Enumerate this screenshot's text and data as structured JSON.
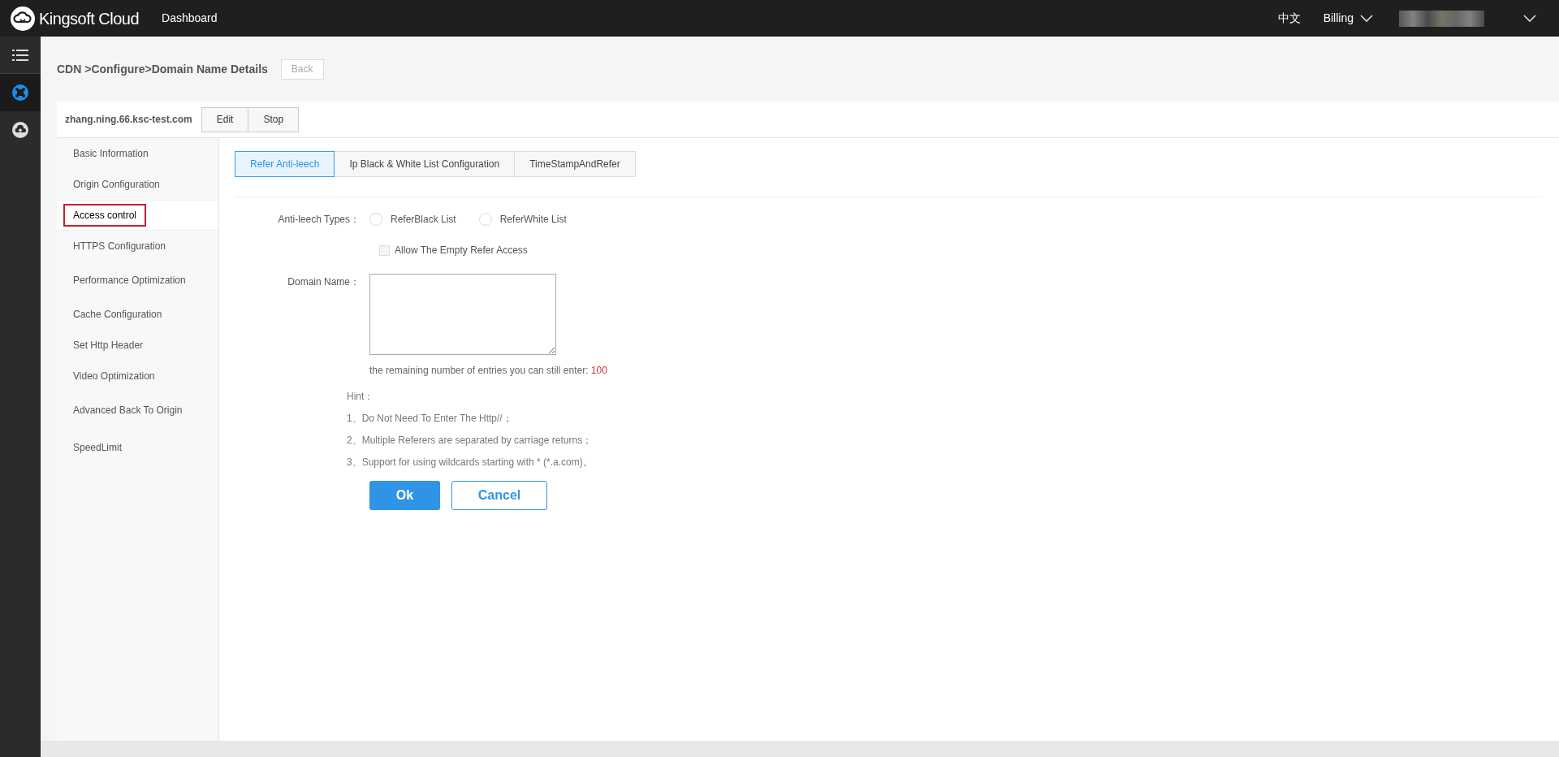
{
  "topbar": {
    "brand": "Kingsoft Cloud",
    "nav": "Dashboard",
    "language": "中文",
    "billing": "Billing"
  },
  "rail": [
    {
      "kind": "menu",
      "selected": false
    },
    {
      "kind": "cdn",
      "selected": true
    },
    {
      "kind": "cloud",
      "selected": false
    }
  ],
  "breadcrumb": "CDN >Configure>Domain Name Details",
  "back_button": "Back",
  "domain": {
    "name": "zhang.ning.66.ksc-test.com",
    "buttons": [
      "Edit",
      "Stop"
    ]
  },
  "side_menu": [
    {
      "label": "Basic Information",
      "selected": false
    },
    {
      "label": "Origin Configuration",
      "selected": false
    },
    {
      "label": "Access control",
      "selected": true
    },
    {
      "label": "HTTPS Configuration",
      "selected": false
    },
    {
      "label": "Performance Optimization",
      "selected": false
    },
    {
      "label": "Cache Configuration",
      "selected": false
    },
    {
      "label": "Set Http Header",
      "selected": false
    },
    {
      "label": "Video Optimization",
      "selected": false
    },
    {
      "label": "Advanced Back To Origin",
      "selected": false
    },
    {
      "label": "SpeedLimit",
      "selected": false
    }
  ],
  "tabs": [
    {
      "label": "Refer Anti-leech",
      "selected": true
    },
    {
      "label": "Ip Black & White List Configuration",
      "selected": false
    },
    {
      "label": "TimeStampAndRefer",
      "selected": false
    }
  ],
  "form": {
    "type_label": "Anti-leech Types：",
    "types": [
      {
        "label": "ReferBlack List",
        "selected": false
      },
      {
        "label": "ReferWhite List",
        "selected": false
      }
    ],
    "allow_empty": {
      "label": "Allow The Empty Refer Access",
      "checked": false
    },
    "domain_label": "Domain Name：",
    "remaining_text": "the remaining number of entries you can still enter:",
    "remaining_count": "100",
    "hint_title": "Hint：",
    "hints": [
      "1、Do Not Need To Enter The Http//；",
      "2、Multiple Referers are separated by carriage returns；",
      "3、Support for using wildcards starting with * (*.a.com)。"
    ],
    "ok": "Ok",
    "cancel": "Cancel"
  }
}
